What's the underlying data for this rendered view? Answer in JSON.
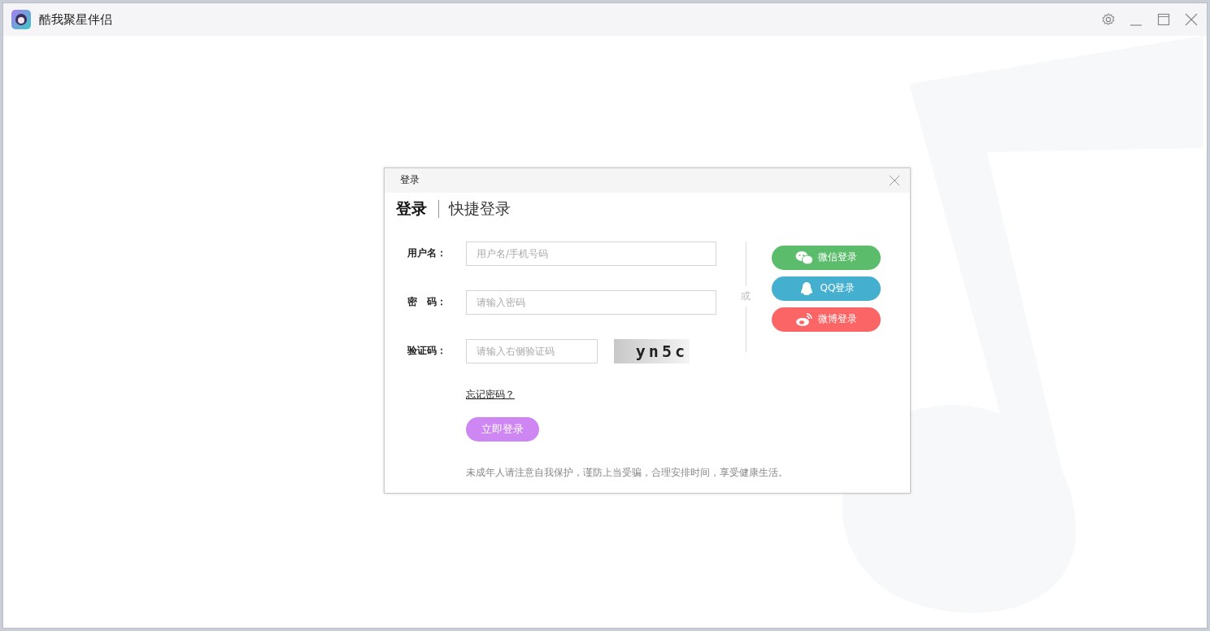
{
  "window": {
    "title": "酷我聚星伴侣"
  },
  "dialog": {
    "title": "登录",
    "tabs": [
      {
        "label": "登录",
        "selected": true
      },
      {
        "label": "快捷登录",
        "selected": false
      }
    ],
    "fields": [
      {
        "label": "用户名：",
        "placeholder": "用户名/手机号码",
        "kind": "text"
      },
      {
        "label": "密　码：",
        "placeholder": "请输入密码",
        "kind": "password"
      },
      {
        "label": "验证码：",
        "placeholder": "请输入右侧验证码",
        "kind": "captcha",
        "captcha": "yn5c"
      }
    ],
    "forgot_link": "忘记密码？",
    "login_button": "立即登录",
    "notice": "未成年人请注意自我保护，谨防上当受骗，合理安排时间，享受健康生活。",
    "separator": "或",
    "social_logins": [
      {
        "label": "微信登录",
        "kind": "wechat",
        "color": "#5bbd6b"
      },
      {
        "label": "QQ登录",
        "kind": "qq",
        "color": "#45afd0"
      },
      {
        "label": "微博登录",
        "kind": "weibo",
        "color": "#fb6565"
      }
    ]
  }
}
